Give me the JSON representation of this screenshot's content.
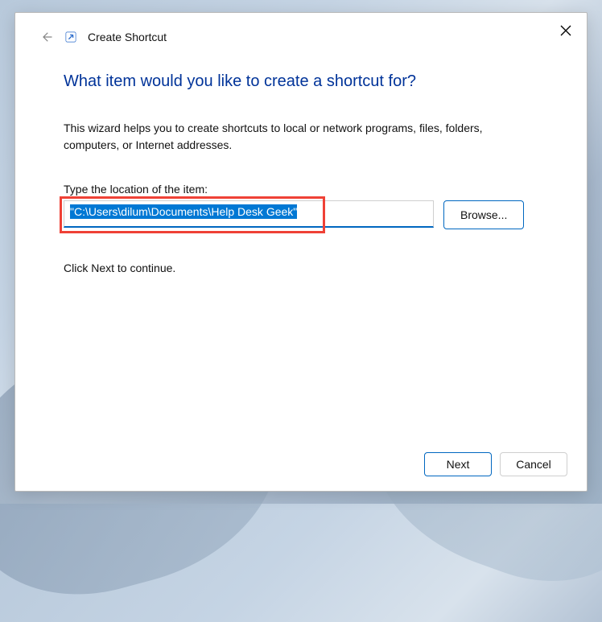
{
  "window": {
    "title": "Create Shortcut"
  },
  "main": {
    "heading": "What item would you like to create a shortcut for?",
    "description": "This wizard helps you to create shortcuts to local or network programs, files, folders, computers, or Internet addresses.",
    "location_label": "Type the location of the item:",
    "location_value": "\"C:\\Users\\dilum\\Documents\\Help Desk Geek\"",
    "browse_label": "Browse...",
    "continue_text": "Click Next to continue."
  },
  "footer": {
    "next_label": "Next",
    "cancel_label": "Cancel"
  }
}
